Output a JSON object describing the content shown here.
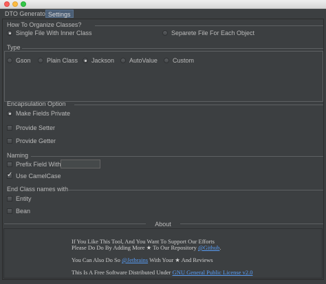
{
  "tabs": [
    {
      "label": "DTO Generator"
    },
    {
      "label": "Settings"
    }
  ],
  "organize": {
    "title": "How To Organize Classes?",
    "options": [
      {
        "label": "Single File With Inner Class",
        "checked": true
      },
      {
        "label": "Separete File For Each Object",
        "checked": false
      }
    ]
  },
  "type": {
    "title": "Type",
    "options": [
      {
        "label": "Gson",
        "checked": false
      },
      {
        "label": "Plain Class",
        "checked": false
      },
      {
        "label": "Jackson",
        "checked": true
      },
      {
        "label": "AutoValue",
        "checked": false
      },
      {
        "label": "Custom",
        "checked": false
      }
    ]
  },
  "encapsulation": {
    "title": "Encapsulation Option",
    "make_private": {
      "label": "Make Fields Private",
      "checked": true
    },
    "provide_setter": {
      "label": "Provide Setter",
      "checked": false
    },
    "provide_getter": {
      "label": "Provide Getter",
      "checked": false
    }
  },
  "naming": {
    "title": "Naming",
    "prefix_field": {
      "label": "Prefix Field With",
      "checked": false,
      "value": ""
    },
    "use_camelcase": {
      "label": "Use CamelCase",
      "checked": true
    }
  },
  "end_class": {
    "title": "End Class names with",
    "entity": {
      "label": "Entity",
      "checked": false
    },
    "bean": {
      "label": "Bean",
      "checked": false
    }
  },
  "about": {
    "title": "About",
    "line1": "If You Like This Tool, And You Want To Support Our Efforts",
    "line2_pre": "Please Do Do By Adding More ★ To Our Repository ",
    "line2_link": "@Github",
    "line2_post": ".",
    "line3_pre": "You Can Also Do So ",
    "line3_link": "@Jetbrains",
    "line3_post": " With Your ★ And Reviews",
    "line4_pre": "This Is A Free Software Distributed Under ",
    "line4_link": "GNU General Public License v2.0"
  }
}
